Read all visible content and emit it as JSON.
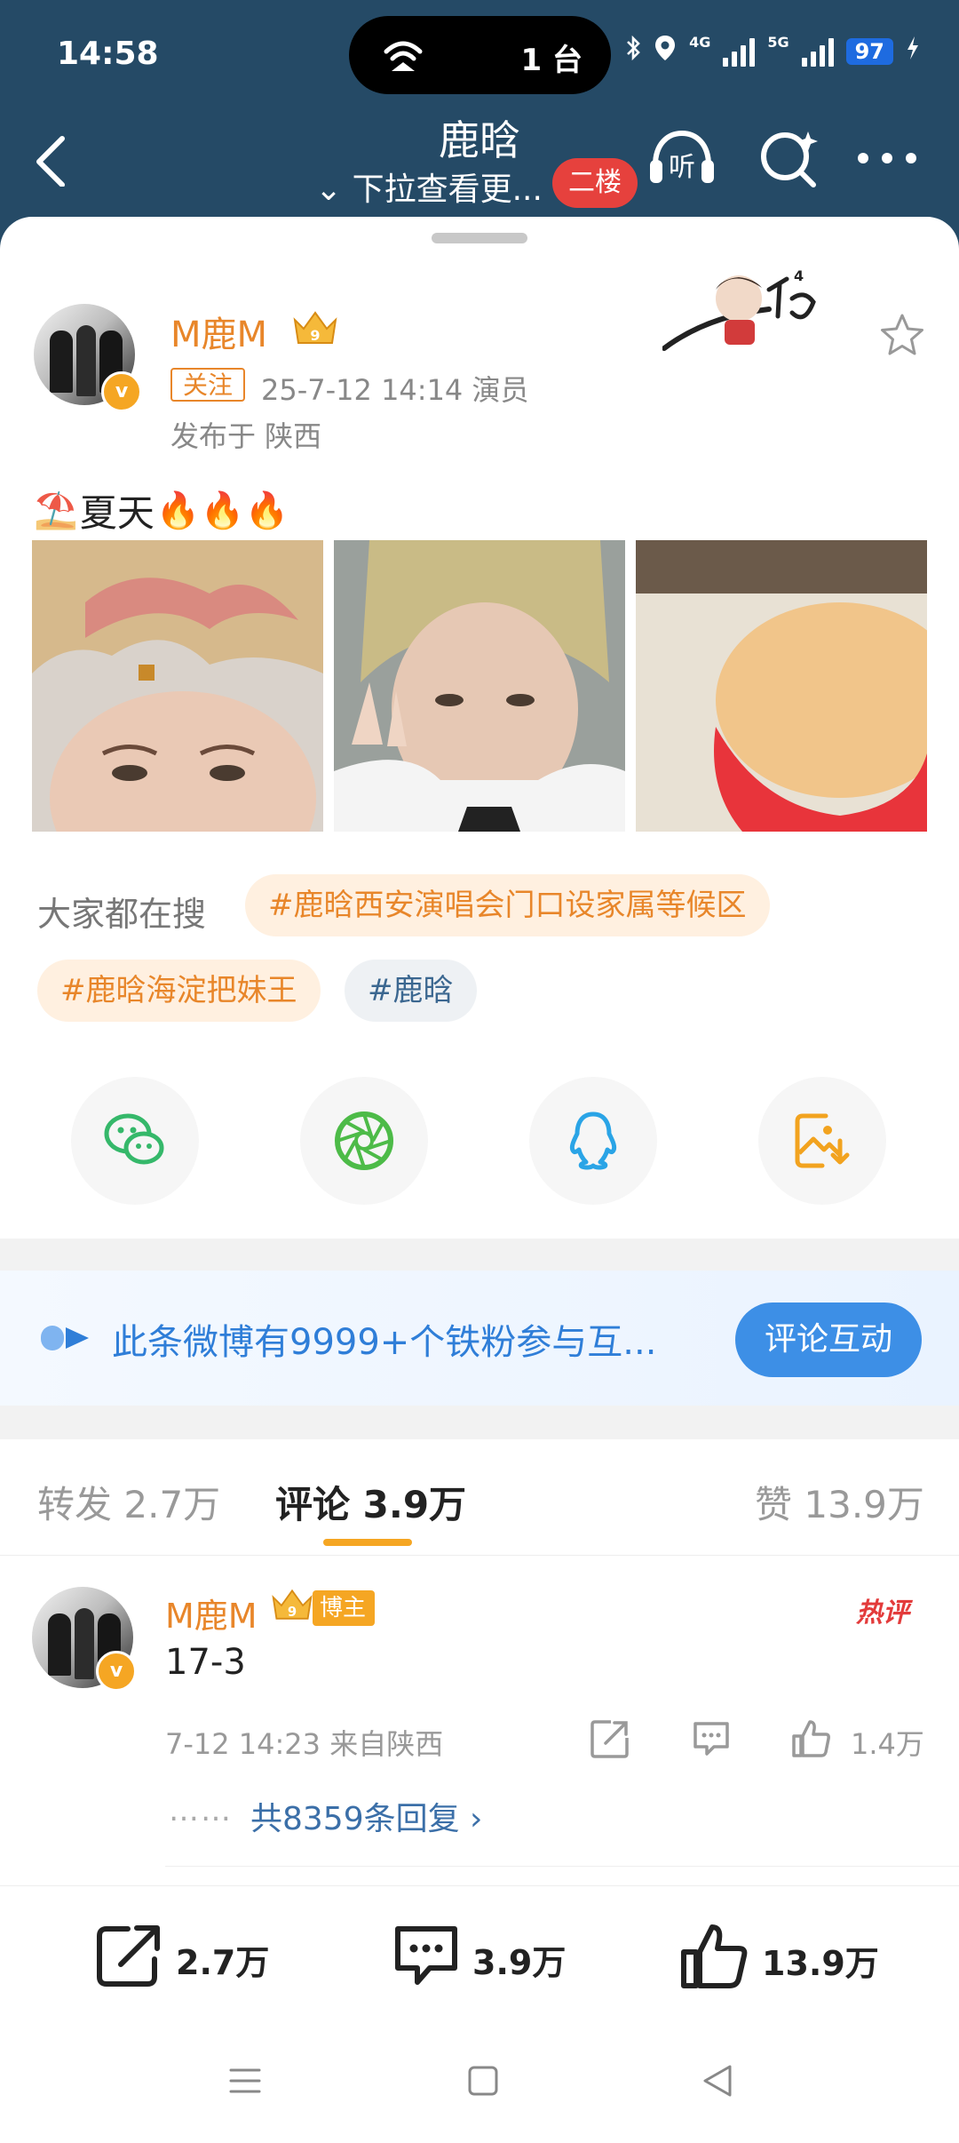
{
  "status_bar": {
    "time": "14:58",
    "cast_label": "1 台",
    "net1": "4G",
    "net2": "5G",
    "battery": "97"
  },
  "nav": {
    "title": "鹿晗",
    "subtitle": "⌄ 下拉查看更...",
    "floor_badge": "二楼",
    "listen_label": "听"
  },
  "post": {
    "username": "M鹿M",
    "follow_label": "关注",
    "meta": "25-7-12 14:14   演员",
    "location": "发布于 陕西",
    "text": "夏天",
    "emoji_prefix": "⛱️",
    "emoji_suffix": "🔥🔥🔥",
    "vip_level": "9",
    "v_mark": "v"
  },
  "search": {
    "label": "大家都在搜",
    "tags": [
      "#鹿晗西安演唱会门口设家属等候区",
      "#鹿晗海淀把妹王",
      "#鹿晗"
    ]
  },
  "share_icons": [
    "wechat-icon",
    "moments-icon",
    "qq-icon",
    "save-image-icon"
  ],
  "fans_banner": {
    "text": "此条微博有9999+个铁粉参与互...",
    "button": "评论互动"
  },
  "tabs": {
    "repost_label": "转发",
    "repost_count": "2.7万",
    "comment_label": "评论",
    "comment_count": "3.9万",
    "like_label": "赞",
    "like_count": "13.9万"
  },
  "comment": {
    "username": "M鹿M",
    "badge": "博主",
    "hot": "热评",
    "text": "17-3",
    "meta": "7-12 14:23  来自陕西",
    "like_count": "1.4万",
    "dots": "……",
    "replies": "共8359条回复 ›"
  },
  "action_bar": {
    "repost": "2.7万",
    "comment": "3.9万",
    "like": "13.9万"
  },
  "colors": {
    "header": "#254a66",
    "accent_orange": "#e8862a",
    "link_blue": "#3b6fa8",
    "red_badge": "#e6413d"
  }
}
